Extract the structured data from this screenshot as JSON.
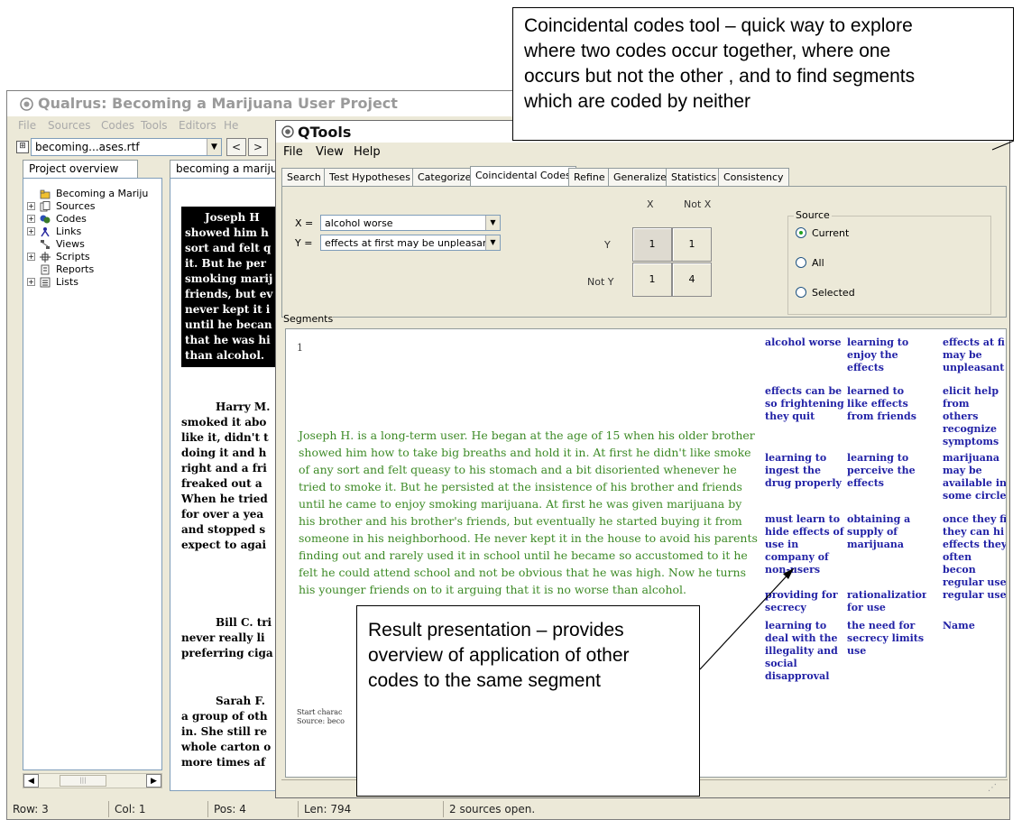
{
  "main_window": {
    "title": "Qualrus: Becoming a Marijuana User Project",
    "menu": [
      "File",
      "Sources",
      "Codes",
      "Tools",
      "Editors",
      "He"
    ],
    "source_select_value": "becoming...ases.rtf",
    "nav_back": "<",
    "nav_forward": ">",
    "tab_project_overview": "Project overview",
    "tab_document": "becoming a mariju",
    "tree": [
      {
        "label": "Becoming a Mariju",
        "expander": ""
      },
      {
        "label": "Sources",
        "expander": "+"
      },
      {
        "label": "Codes",
        "expander": "+"
      },
      {
        "label": "Links",
        "expander": "+"
      },
      {
        "label": "Views",
        "expander": ""
      },
      {
        "label": "Scripts",
        "expander": "+"
      },
      {
        "label": "Reports",
        "expander": ""
      },
      {
        "label": "Lists",
        "expander": "+"
      }
    ],
    "doc_highlight_lines": [
      "Joseph H",
      "showed him h",
      "sort and felt q",
      "it.  But he per",
      "smoking marij",
      "friends, but ev",
      "never kept it i",
      "until he becan",
      "that he was hi",
      "than alcohol."
    ],
    "doc_para2": [
      "Harry M.",
      "smoked it abo",
      "like it, didn't t",
      "doing it and h",
      "right and a fri",
      "freaked out a",
      "When he tried",
      "for over a yea",
      "and stopped s",
      "expect to agai"
    ],
    "doc_para3": [
      "Bill C. tri",
      "never really li",
      "preferring ciga"
    ],
    "doc_para4": [
      "Sarah F.",
      "a group of oth",
      "in.  She still re",
      "whole carton o",
      "more times af"
    ],
    "status": {
      "row": "Row: 3",
      "col": "Col: 1",
      "pos": "Pos: 4",
      "len": "Len: 794",
      "msg": "2 sources open."
    }
  },
  "qtools": {
    "title": "QTools",
    "menu": [
      "File",
      "View",
      "Help"
    ],
    "tabs": [
      "Search",
      "Test Hypotheses",
      "Categorize",
      "Coincidental Codes",
      "Refine",
      "Generalize",
      "Statistics",
      "Consistency"
    ],
    "active_tab": "Coincidental Codes",
    "x_label": "X =",
    "y_label": "Y =",
    "x_value": "alcohol worse",
    "y_value": "effects at first may be unpleasant",
    "matrix": {
      "col_x": "X",
      "col_notx": "Not X",
      "row_y": "Y",
      "row_noty": "Not Y",
      "y_x": "1",
      "y_notx": "1",
      "noty_x": "1",
      "noty_notx": "4"
    },
    "source_group": {
      "legend": "Source",
      "options": [
        "Current",
        "All",
        "Selected"
      ],
      "selected": "Current"
    },
    "segments_label": "Segments",
    "segment_number": "1",
    "segment_text": "Joseph H. is a long-term user. He began at the age of 15 when his older brother showed him how to take big breaths and hold it in. At first he didn't like smoke of any sort and felt queasy to his stomach and a bit disoriented whenever he tried to smoke it. But he persisted at the insistence of his brother and friends until he came to enjoy smoking marijuana. At first he was given marijuana by his brother and his brother's friends, but eventually he started buying it from someone in his neighborhood. He never kept it in the house to avoid his parents finding out and rarely used it in school until he became so accustomed to it he felt he could attend school and not be obvious that he was high. Now he turns his younger friends on to it arguing that it is no worse than alcohol.",
    "segment_meta": [
      "Start charac",
      "Source: beco"
    ],
    "code_rows": [
      [
        "alcohol worse",
        "learning to enjoy the effects",
        "effects at fi may be unpleasant"
      ],
      [
        "effects can be so frightening they quit",
        "learned to like effects from friends",
        "elicit help from others recognize symptoms"
      ],
      [
        "learning to ingest the drug properly",
        "learning to perceive the effects",
        "marijuana may be available in some circle"
      ],
      [
        "must learn to hide effects of use in company of non-users",
        "obtaining a supply of marijuana",
        "once they fi they can hi effects they often becon regular use"
      ],
      [
        "providing for secrecy",
        "rationalizations for use",
        "regular use"
      ],
      [
        "learning to deal with the illegality and social disapproval",
        "the need for secrecy limits use",
        "Name"
      ]
    ]
  },
  "callouts": {
    "top": [
      "Coincidental codes tool – quick way to explore",
      "where two codes occur together, where one",
      "occurs but not the other , and to find segments",
      "which are coded by neither"
    ],
    "bottom": [
      "Result presentation – provides",
      "overview of application of other",
      "codes to the same segment"
    ]
  }
}
